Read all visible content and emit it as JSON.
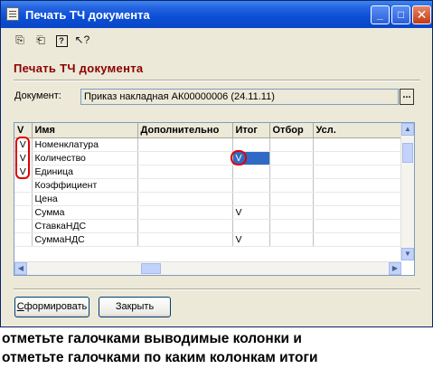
{
  "window": {
    "title": "Печать ТЧ документа"
  },
  "title_buttons": [
    "minimize-icon",
    "maximize-icon",
    "close-icon"
  ],
  "toolbar": {
    "icons": [
      "save-settings-icon",
      "restore-settings-icon",
      "help-icon",
      "context-help-icon"
    ]
  },
  "form": {
    "title": "Печать ТЧ документа"
  },
  "document": {
    "label": "Документ:",
    "value": "Приказ накладная АК00000006 (24.11.11)",
    "select_button": "..."
  },
  "grid": {
    "columns": [
      "V",
      "Имя",
      "Дополнительно",
      "Итог",
      "Отбор",
      "Усл."
    ],
    "rows": [
      {
        "v": "V",
        "name": "Номенклатура",
        "extra": "",
        "itog": "",
        "otbor": "",
        "usl": ""
      },
      {
        "v": "V",
        "name": "Количество",
        "extra": "",
        "itog": "V",
        "otbor": "",
        "usl": ""
      },
      {
        "v": "V",
        "name": "Единица",
        "extra": "",
        "itog": "",
        "otbor": "",
        "usl": ""
      },
      {
        "v": "",
        "name": "Коэффициент",
        "extra": "",
        "itog": "",
        "otbor": "",
        "usl": ""
      },
      {
        "v": "",
        "name": "Цена",
        "extra": "",
        "itog": "",
        "otbor": "",
        "usl": ""
      },
      {
        "v": "",
        "name": "Сумма",
        "extra": "",
        "itog": "V",
        "otbor": "",
        "usl": ""
      },
      {
        "v": "",
        "name": "СтавкаНДС",
        "extra": "",
        "itog": "",
        "otbor": "",
        "usl": ""
      },
      {
        "v": "",
        "name": "СуммаНДС",
        "extra": "",
        "itog": "V",
        "otbor": "",
        "usl": ""
      }
    ],
    "selected_row": 1
  },
  "buttons": {
    "form": "Сформировать",
    "form_hotkey": "С",
    "form_rest": "формировать",
    "close": "Закрыть"
  },
  "captions": [
    "отметьте галочками выводимые колонки и",
    "отметьте галочками по каким колонкам итоги"
  ],
  "colors": {
    "titlebar": "#0a46c6",
    "form_title": "#8b0000",
    "annotation": "#e00000",
    "selection": "#316ac5"
  }
}
